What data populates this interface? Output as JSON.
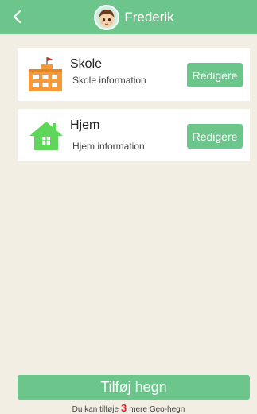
{
  "header": {
    "title": "Frederik",
    "back_icon": "chevron-left-icon",
    "avatar_icon": "child-avatar-icon",
    "background_color": "#6cc58b"
  },
  "geofences": [
    {
      "title": "Skole",
      "subtitle": "Skole information",
      "icon": "school-icon",
      "edit_label": "Redigere"
    },
    {
      "title": "Hjem",
      "subtitle": "Hjem information",
      "icon": "home-icon",
      "edit_label": "Redigere"
    }
  ],
  "add_button": {
    "label": "Tilføj hegn"
  },
  "footer": {
    "prefix": "Du kan tilføje",
    "count": "3",
    "suffix": "mere Geo-hegn",
    "count_color": "#e8231f"
  },
  "colors": {
    "accent": "#6cc58b",
    "background": "#f3eee4",
    "school_orange": "#f49a3b",
    "home_green": "#5dd65a"
  }
}
